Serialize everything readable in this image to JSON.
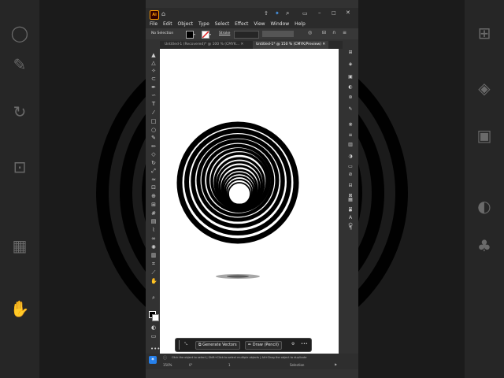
{
  "app": {
    "logo": "Ai"
  },
  "menu": [
    "File",
    "Edit",
    "Object",
    "Type",
    "Select",
    "Effect",
    "View",
    "Window",
    "Help"
  ],
  "control_bar": {
    "selection": "No Selection",
    "stroke_label": "Stroke"
  },
  "tabs": [
    {
      "label": "Untitled-1 (Recovered)* @ 100 % (CMYK...",
      "active": false
    },
    {
      "label": "Untitled-1* @ 150 % (CMYK/Preview)",
      "active": true
    }
  ],
  "context_bar": {
    "generate": "Generate Vectors",
    "draw": "Draw (Pencil)",
    "more": "•••"
  },
  "status": {
    "hint": "Click the object to select  |  Shift+Click to select multiple objects  |  Alt+Drag the object to duplicate",
    "zoom": "150%",
    "rotation": "0°",
    "artboard": "1",
    "mode": "Selection"
  },
  "icons": {
    "titlebar": [
      "home-icon",
      "share-icon",
      "discover-icon",
      "search-icon",
      "arrange-icon",
      "minimize-icon",
      "maximize-icon",
      "close-icon"
    ],
    "tools": [
      "selection-icon",
      "direct-selection-icon",
      "magic-wand-icon",
      "lasso-icon",
      "pen-icon",
      "curvature-icon",
      "type-icon",
      "line-icon",
      "rectangle-icon",
      "ellipse-icon",
      "paintbrush-icon",
      "pencil-icon",
      "eraser-icon",
      "rotate-icon",
      "scale-icon",
      "width-icon",
      "free-transform-icon",
      "shape-builder-icon",
      "perspective-icon",
      "mesh-icon",
      "gradient-icon",
      "eyedropper-icon",
      "blend-icon",
      "symbol-sprayer-icon",
      "column-graph-icon",
      "artboard-icon",
      "slice-icon",
      "hand-icon",
      "zoom-icon"
    ],
    "right": [
      "properties-icon",
      "layers-icon",
      "libraries-icon",
      "color-icon",
      "swatches-icon",
      "brushes-icon",
      "symbols-icon",
      "stroke-icon",
      "gradient-panel-icon",
      "transparency-icon",
      "appearance-icon",
      "graphic-styles-icon",
      "align-icon",
      "pathfinder-icon",
      "transform-icon",
      "character-icon",
      "paragraph-icon",
      "links-icon",
      "image-trace-icon",
      "3d-icon"
    ]
  },
  "colors": {
    "accent": "#2680eb",
    "canvas": "#ffffff",
    "ui_dark": "#323232"
  }
}
